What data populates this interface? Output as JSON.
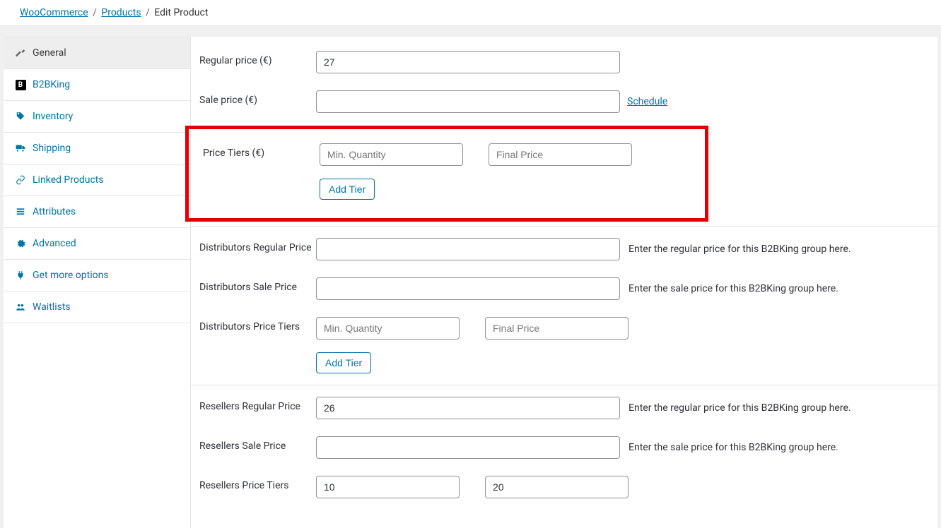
{
  "breadcrumb": {
    "woo": "WooCommerce",
    "products": "Products",
    "current": "Edit Product"
  },
  "sidebar": {
    "general": "General",
    "b2bking": "B2BKing",
    "inventory": "Inventory",
    "shipping": "Shipping",
    "linked": "Linked Products",
    "attributes": "Attributes",
    "advanced": "Advanced",
    "more": "Get more options",
    "waitlists": "Waitlists"
  },
  "labels": {
    "regular_price": "Regular price (€)",
    "sale_price": "Sale price (€)",
    "price_tiers": "Price Tiers (€)",
    "schedule": "Schedule",
    "add_tier": "Add Tier",
    "min_qty": "Min. Quantity",
    "final_price": "Final Price",
    "dist_reg": "Distributors Regular Price",
    "dist_sale": "Distributors Sale Price",
    "dist_tiers": "Distributors Price Tiers",
    "res_reg": "Resellers Regular Price",
    "res_sale": "Resellers Sale Price",
    "res_tiers": "Resellers Price Tiers",
    "hint_reg": "Enter the regular price for this B2BKing group here.",
    "hint_sale": "Enter the sale price for this B2BKing group here."
  },
  "values": {
    "regular_price": "27",
    "sale_price": "",
    "dist_reg": "",
    "dist_sale": "",
    "res_reg": "26",
    "res_sale": "",
    "res_tier_qty": "10",
    "res_tier_price": "20"
  }
}
